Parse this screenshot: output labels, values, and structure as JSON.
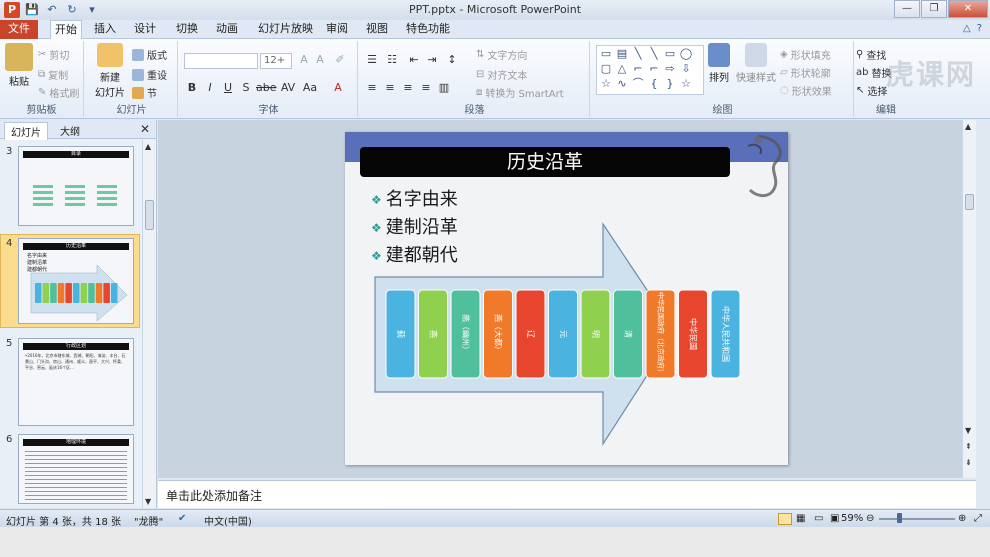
{
  "window": {
    "title": "PPT.pptx - Microsoft PowerPoint",
    "app_letter": "P",
    "controls": [
      "—",
      "❐",
      "✕"
    ]
  },
  "tabs": [
    "文件",
    "开始",
    "插入",
    "设计",
    "切换",
    "动画",
    "幻灯片放映",
    "审阅",
    "视图",
    "特色功能"
  ],
  "ribbon": {
    "clipboard": {
      "paste": "粘贴",
      "cut": "剪切",
      "copy": "复制",
      "format_painter": "格式刷",
      "label": "剪贴板"
    },
    "slides": {
      "new_slide_line1": "新建",
      "new_slide_line2": "幻灯片",
      "layout": "版式",
      "reset": "重设",
      "section": "节",
      "label": "幻灯片"
    },
    "font": {
      "size": "12+",
      "label": "字体"
    },
    "paragraph": {
      "text_direction": "文字方向",
      "align_text": "对齐文本",
      "convert_smartart": "转换为 SmartArt",
      "label": "段落"
    },
    "drawing": {
      "arrange": "排列",
      "quick_styles": "快速样式",
      "shape_fill": "形状填充",
      "shape_outline": "形状轮廓",
      "shape_effects": "形状效果",
      "label": "绘图"
    },
    "editing": {
      "find": "查找",
      "replace": "替换",
      "select": "选择",
      "label": "编辑"
    },
    "watermark": "虎课网"
  },
  "left_pane": {
    "tab_slides": "幻灯片",
    "tab_outline": "大纲",
    "close": "✕",
    "thumbs": [
      {
        "num": "3",
        "title": "目录"
      },
      {
        "num": "4",
        "title": "历史沿革",
        "lines": [
          "名字由来",
          "建制沿革",
          "建都朝代"
        ]
      },
      {
        "num": "5",
        "title": "行政区划",
        "text": "•2016年，北京市辖东城、西城、朝阳、海淀、丰台、石景山、门头沟、房山、通州、顺义、昌平、大兴、怀柔、平谷、密云、延庆16个区..."
      },
      {
        "num": "6",
        "title": "地理环境"
      }
    ]
  },
  "slide": {
    "title": "历史沿革",
    "bullets": [
      "名字由来",
      "建制沿革",
      "建都朝代"
    ],
    "dynasties": [
      {
        "label": "蓟",
        "color": "#4ab3e0"
      },
      {
        "label": "燕",
        "color": "#8fd14f"
      },
      {
        "label": "燕（幽州）",
        "color": "#4fbf9c"
      },
      {
        "label": "燕（大都）",
        "color": "#f07a2a"
      },
      {
        "label": "辽",
        "color": "#e8452f"
      },
      {
        "label": "元",
        "color": "#4ab3e0"
      },
      {
        "label": "明",
        "color": "#8fd14f"
      },
      {
        "label": "清",
        "color": "#4fbf9c"
      },
      {
        "label": "中华民国政府（北京政府）",
        "color": "#f07a2a"
      },
      {
        "label": "中华民国",
        "color": "#e8452f"
      },
      {
        "label": "中华人民共和国",
        "color": "#4ab3e0"
      }
    ]
  },
  "notes": {
    "placeholder": "单击此处添加备注"
  },
  "status": {
    "slide_info": "幻灯片 第 4 张，共 18 张",
    "theme": "\"龙腾\"",
    "language": "中文(中国)",
    "zoom": "59%"
  }
}
